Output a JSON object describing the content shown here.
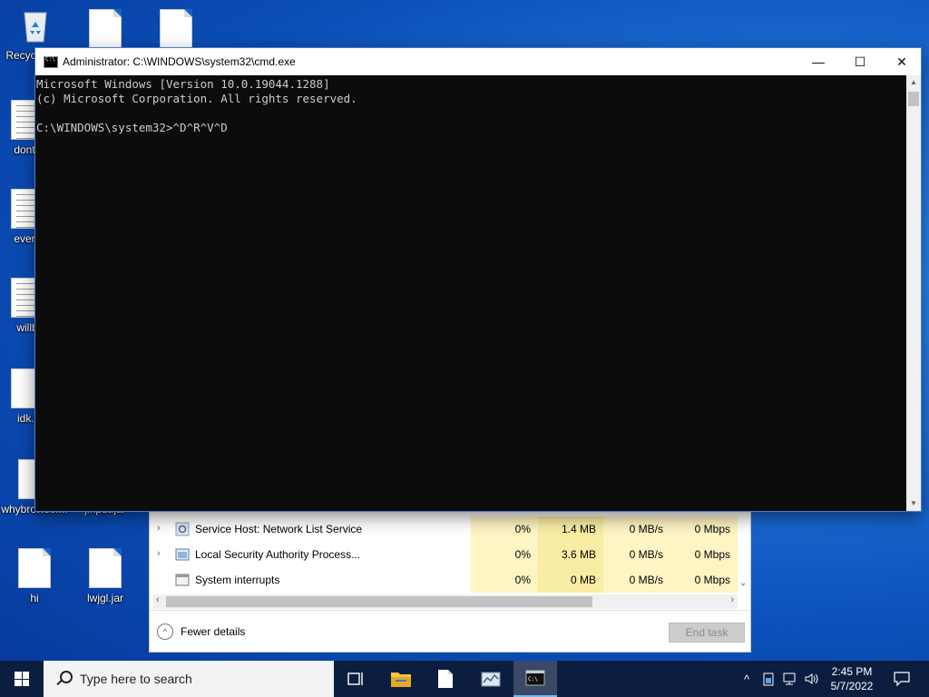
{
  "desktop": {
    "icons": [
      {
        "label": "Recycle Bin"
      },
      {
        "label": "dontv"
      },
      {
        "label": "every"
      },
      {
        "label": "willb"
      },
      {
        "label": "idk.t"
      },
      {
        "label": "whybrowser..."
      },
      {
        "label": "jinput.jar"
      },
      {
        "label": "hi"
      },
      {
        "label": "lwjgl.jar"
      }
    ]
  },
  "cmd": {
    "title": "Administrator: C:\\WINDOWS\\system32\\cmd.exe",
    "output": "Microsoft Windows [Version 10.0.19044.1288]\n(c) Microsoft Corporation. All rights reserved.\n\nC:\\WINDOWS\\system32>^D^R^V^D",
    "buttons": {
      "minimize": "—",
      "maximize": "☐",
      "close": "✕"
    }
  },
  "taskmgr": {
    "rows": [
      {
        "name": "Service Host: Network List Service",
        "cpu": "0%",
        "memory": "1.4 MB",
        "disk": "0 MB/s",
        "network": "0 Mbps",
        "expandable": true
      },
      {
        "name": "Local Security Authority Process...",
        "cpu": "0%",
        "memory": "3.6 MB",
        "disk": "0 MB/s",
        "network": "0 Mbps",
        "expandable": true
      },
      {
        "name": "System interrupts",
        "cpu": "0%",
        "memory": "0 MB",
        "disk": "0 MB/s",
        "network": "0 Mbps",
        "expandable": false
      }
    ],
    "fewer_details": "Fewer details",
    "end_task": "End task"
  },
  "taskbar": {
    "search_placeholder": "Type here to search",
    "clock_time": "2:45 PM",
    "clock_date": "5/7/2022",
    "apps": [
      "task-view-icon",
      "file-explorer-icon",
      "notepad-icon",
      "task-manager-icon",
      "cmd-icon"
    ]
  }
}
